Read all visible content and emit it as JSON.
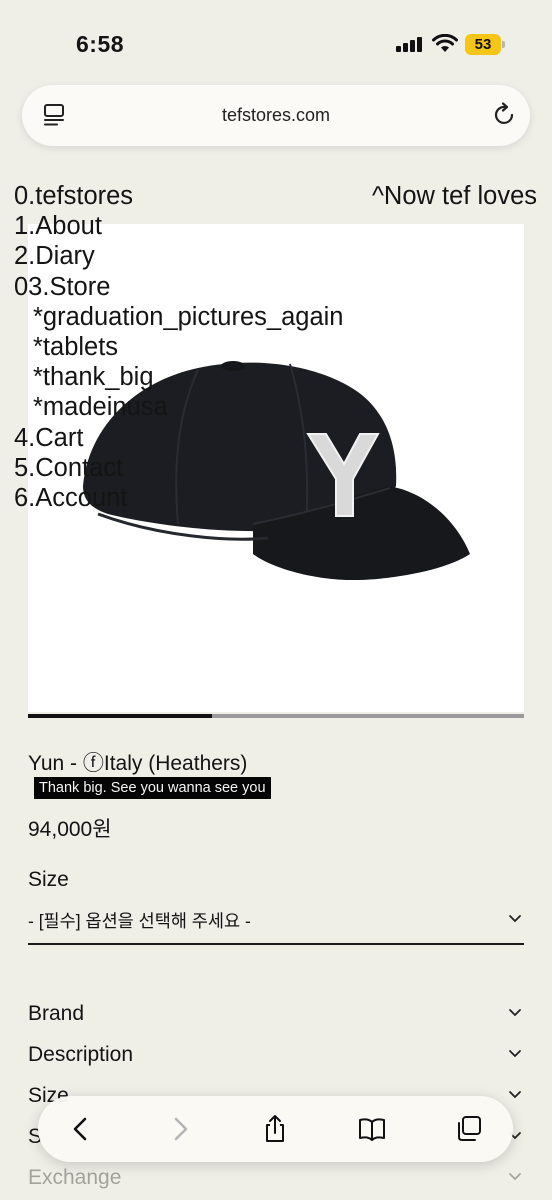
{
  "status": {
    "time": "6:58",
    "battery": "53"
  },
  "browser": {
    "url": "tefstores.com",
    "toolbar": {
      "back": "back",
      "forward": "forward",
      "share": "share",
      "bookmarks": "bookmarks",
      "tabs": "tabs"
    }
  },
  "site": {
    "nav": {
      "home": "0.tefstores",
      "about": "1.About",
      "diary": "2.Diary",
      "store": "03.Store",
      "store_sub": [
        "*graduation_pictures_again",
        "*tablets",
        "*thank_big",
        "*madeinusa"
      ],
      "cart": "4.Cart",
      "contact": "5.Contact",
      "account": "6.Account"
    },
    "now_loves": "^Now tef loves"
  },
  "gallery": {
    "progress": 0.37
  },
  "product": {
    "name": "Yun - ⓕItaly (Heathers)",
    "promo": "Thank big. See you wanna see you",
    "price": "94,000원",
    "size_label": "Size",
    "size_select": "- [필수] 옵션을 선택해 주세요 -"
  },
  "accordion": [
    "Brand",
    "Description",
    "Size",
    "S",
    "Exchange"
  ],
  "colors": {
    "background": "#efeee7",
    "ink": "#141414",
    "battery": "#f5c518"
  }
}
